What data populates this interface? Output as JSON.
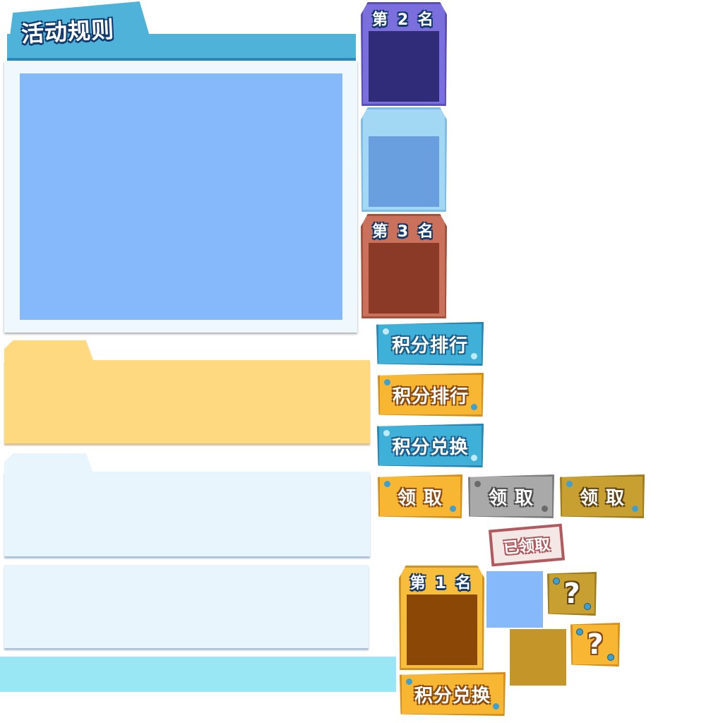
{
  "rules_panel": {
    "title": "活动规则"
  },
  "rank_cards": {
    "second": {
      "label": "第 2 名"
    },
    "third": {
      "label": "第 3 名"
    },
    "first": {
      "label": "第 1 名"
    }
  },
  "buttons": {
    "ranking_blue": "积分排行",
    "ranking_orange": "积分排行",
    "exchange_blue": "积分兑换",
    "claim_orange": "领 取",
    "claim_gray": "领 取",
    "claim_gold": "领 取",
    "claimed_stamp": "已领取",
    "exchange_orange": "积分兑换"
  },
  "mystery": {
    "symbol": "?"
  },
  "colors": {
    "panel_blue": "#86b9fc",
    "panel_header": "#4fb3d9",
    "folder_yellow": "#fed97f",
    "folder_light": "#e8f5fd",
    "bar_cyan": "#99e7f5",
    "rank2": "#7b6fde",
    "rank3": "#c9715a",
    "rank1": "#f7bd3c"
  }
}
